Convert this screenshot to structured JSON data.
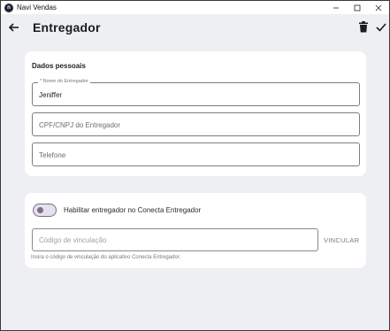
{
  "window": {
    "title": "Navi Vendas",
    "app_icon_letter": "n"
  },
  "appbar": {
    "title": "Entregador"
  },
  "personal": {
    "section_title": "Dados pessoais",
    "name": {
      "label": "* Nome do Entregador",
      "value": "Jeniffer"
    },
    "cpf": {
      "placeholder": "CPF/CNPJ do Entregador"
    },
    "phone": {
      "placeholder": "Telefone"
    }
  },
  "connect": {
    "toggle_label": "Habilitar entregador no Conecta Entregador",
    "toggle_on": false,
    "code_placeholder": "Código de vinculação",
    "link_button": "VINCULAR",
    "helper_text": "Insira o código de vinculação do aplicativo Conecta Entregador."
  },
  "colors": {
    "background": "#eeeff3",
    "card": "#ffffff",
    "toggle_accent": "#7a6f87"
  }
}
